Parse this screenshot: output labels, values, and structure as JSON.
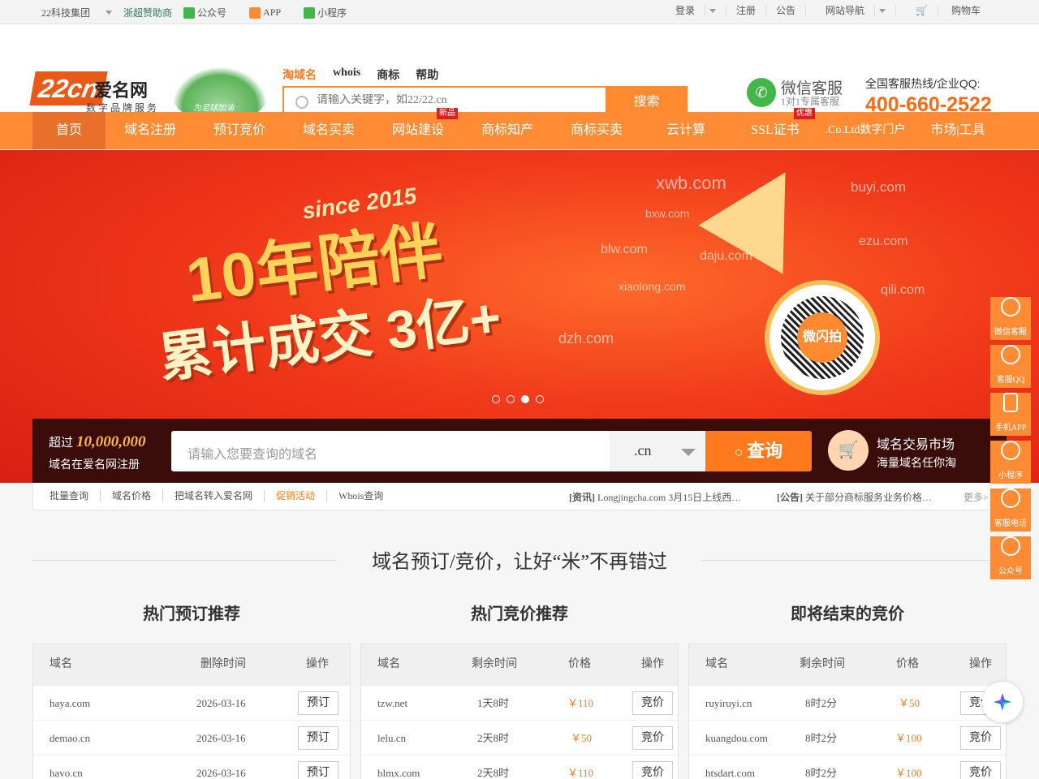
{
  "topbar": {
    "group": "22科技集团",
    "sponsor": "浙超赞助商",
    "wechat_official": "公众号",
    "app": "APP",
    "mini_program": "小程序",
    "login": "登录",
    "register": "注册",
    "notice": "公告",
    "site_nav": "网站导航",
    "cart": "购物车"
  },
  "header": {
    "logo_number": "22cn",
    "logo_name": "爱名网",
    "logo_slogan": "数字品牌服务",
    "player_slogan": "为足球加油",
    "search_tabs": [
      "淘域名",
      "whois",
      "商标",
      "帮助"
    ],
    "search_placeholder": "请输入关键字，如22/22.cn",
    "search_button": "搜索",
    "wechat_service_title": "微信客服",
    "wechat_service_sub": "1对1专属客服",
    "hotline_label": "全国客服热线/企业QQ:",
    "hotline_number": "400-660-2522"
  },
  "nav": {
    "items": [
      {
        "label": "首页",
        "badge": ""
      },
      {
        "label": "域名注册",
        "badge": ""
      },
      {
        "label": "预订竞价",
        "badge": ""
      },
      {
        "label": "域名买卖",
        "badge": ""
      },
      {
        "label": "网站建设",
        "badge": "新品"
      },
      {
        "label": "商标知产",
        "badge": ""
      },
      {
        "label": "商标买卖",
        "badge": ""
      },
      {
        "label": "云计算",
        "badge": ""
      },
      {
        "label": "SSL证书",
        "badge": "优惠"
      },
      {
        "label": ".Co.Ltd数字门户",
        "badge": ""
      },
      {
        "label": "市场|工具",
        "badge": ""
      }
    ]
  },
  "banner": {
    "since": "since 2015",
    "line1": "10年陪伴",
    "line2": "累计成交 3亿+",
    "domains": [
      "xwb.com",
      "buyi.com",
      "bxw.com",
      "blw.com",
      "daju.com",
      "ezu.com",
      "xiaolong.com",
      "qili.com",
      "dzh.com"
    ],
    "qr_label": "微闪拍",
    "qr_url": "P.22.CN",
    "slide_count": 4,
    "active_slide": 3
  },
  "query": {
    "count_prefix": "超过",
    "count": "10,000,000",
    "count_suffix": "域名在爱名网注册",
    "placeholder": "请输入您要查询的域名",
    "tld": ".cn",
    "button": "查询",
    "market_title": "域名交易市场",
    "market_sub": "海量域名任你淘"
  },
  "links": {
    "items": [
      "批量查询",
      "域名价格",
      "把域名转入爱名网",
      "促销活动",
      "Whois查询"
    ],
    "news1_tag": "[资讯]",
    "news1_text": "Longjingcha.com 3月15日上线西…",
    "news2_tag": "[公告]",
    "news2_text": "关于部分商标服务业务价格…",
    "more": "更多>"
  },
  "section": {
    "title": "域名预订/竞价，让好“米”不再错过"
  },
  "tables": {
    "reserve": {
      "title": "热门预订推荐",
      "headers": [
        "域名",
        "删除时间",
        "操作"
      ],
      "rows": [
        {
          "domain": "haya.com",
          "time": "2026-03-16",
          "action": "预订"
        },
        {
          "domain": "demao.cn",
          "time": "2026-03-16",
          "action": "预订"
        },
        {
          "domain": "havo.cn",
          "time": "2026-03-16",
          "action": "预订"
        }
      ]
    },
    "auction": {
      "title": "热门竞价推荐",
      "headers": [
        "域名",
        "剩余时间",
        "价格",
        "操作"
      ],
      "rows": [
        {
          "domain": "tzw.net",
          "time": "1天8时",
          "price": "￥110",
          "action": "竞价"
        },
        {
          "domain": "lelu.cn",
          "time": "2天8时",
          "price": "￥50",
          "action": "竞价"
        },
        {
          "domain": "blmx.com",
          "time": "2天8时",
          "price": "￥110",
          "action": "竞价"
        }
      ]
    },
    "ending": {
      "title": "即将结束的竞价",
      "headers": [
        "域名",
        "剩余时间",
        "价格",
        "操作"
      ],
      "rows": [
        {
          "domain": "ruyiruyi.cn",
          "time": "8时2分",
          "price": "￥50",
          "action": "竞价"
        },
        {
          "domain": "kuangdou.com",
          "time": "8时2分",
          "price": "￥100",
          "action": "竞价"
        },
        {
          "domain": "htsdart.com",
          "time": "8时2分",
          "price": "￥100",
          "action": "竞价"
        }
      ]
    }
  },
  "sidebar": {
    "items": [
      "微信客服",
      "客服QQ",
      "手机APP",
      "小程序",
      "客服电话",
      "公众号"
    ]
  },
  "colors": {
    "accent": "#ff8c35",
    "price": "#ff7a1c",
    "hotline": "#ff6a13"
  }
}
